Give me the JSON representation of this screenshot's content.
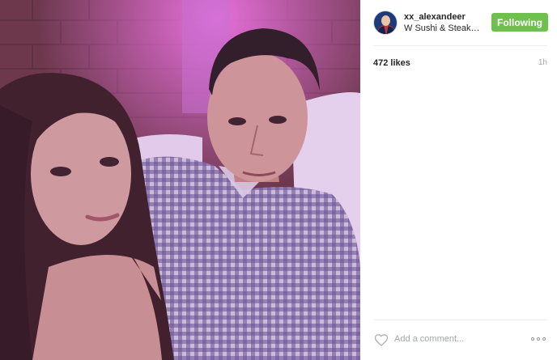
{
  "post": {
    "username": "xx_alexandeer",
    "location": "W Sushi & Steakhouse",
    "follow_label": "Following",
    "likes": "472 likes",
    "time_ago": "1h",
    "comment_placeholder": "Add a comment...",
    "icons": {
      "avatar": "profile-avatar",
      "like": "heart-outline-icon",
      "options": "more-options-icon"
    }
  },
  "colors": {
    "follow_button": "#70c050",
    "muted_text": "#a5a7aa"
  }
}
